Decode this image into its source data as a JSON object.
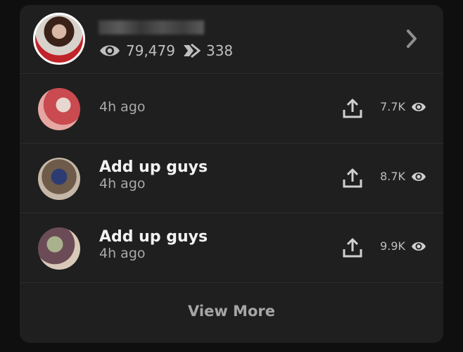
{
  "header": {
    "views": "79,479",
    "shares": "338",
    "icons": {
      "views": "eye-icon",
      "shares": "share-arrows-icon",
      "chevron": "chevron-right-icon"
    }
  },
  "items": [
    {
      "title": "",
      "time": "4h ago",
      "views": "7.7K"
    },
    {
      "title": "Add up guys",
      "time": "4h ago",
      "views": "8.7K"
    },
    {
      "title": "Add up guys",
      "time": "4h ago",
      "views": "9.9K"
    }
  ],
  "footer": {
    "view_more_label": "View More"
  },
  "colors": {
    "background": "#1f1f1f",
    "page": "#0f0f0f",
    "text": "#f2f2f2",
    "muted": "#a9a9a9"
  }
}
